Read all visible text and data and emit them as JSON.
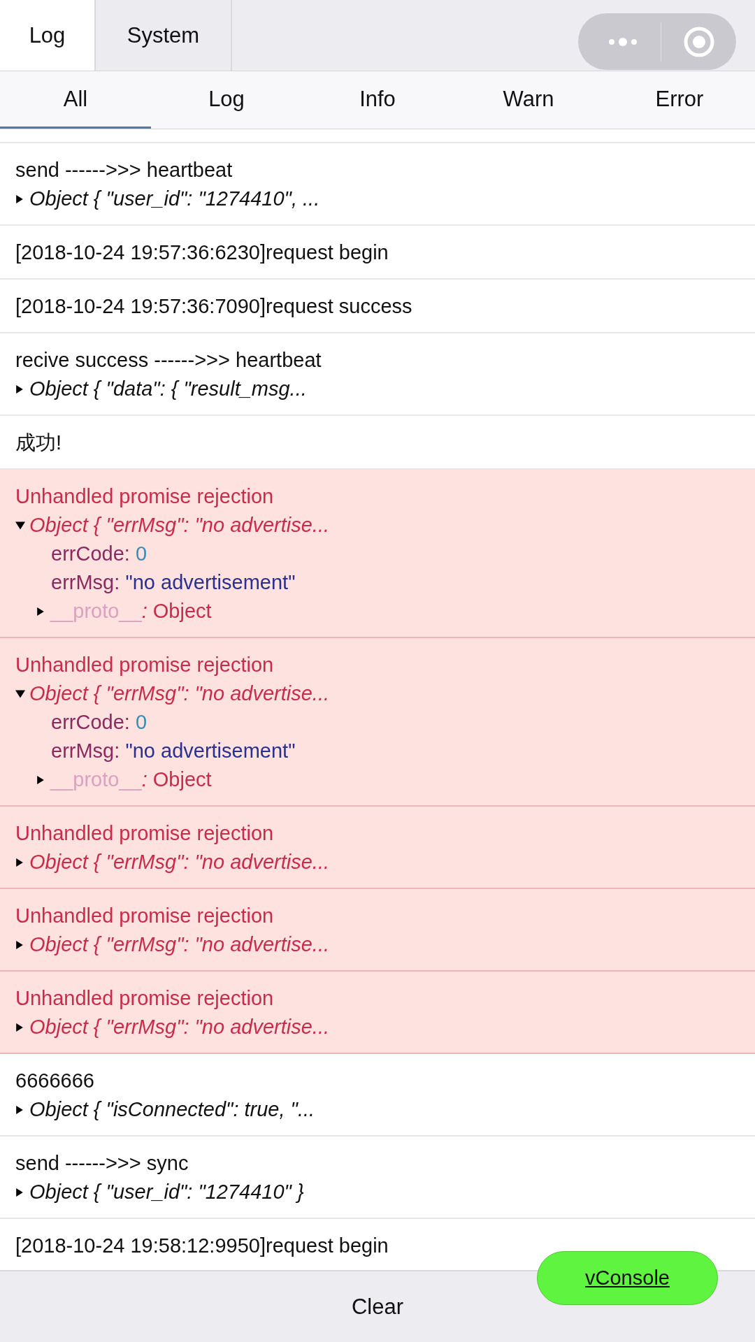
{
  "tabs": [
    {
      "label": "Log",
      "selected": true
    },
    {
      "label": "System",
      "selected": false
    }
  ],
  "filters": [
    {
      "label": "All",
      "selected": true
    },
    {
      "label": "Log",
      "selected": false
    },
    {
      "label": "Info",
      "selected": false
    },
    {
      "label": "Warn",
      "selected": false
    },
    {
      "label": "Error",
      "selected": false
    }
  ],
  "logs": [
    {
      "kind": "log",
      "message": "send ------>>> heartbeat",
      "object": {
        "summary": "Object { \"user_id\": \"1274410\", ...",
        "expanded": false
      }
    },
    {
      "kind": "log",
      "message": "[2018-10-24 19:57:36:6230]request begin"
    },
    {
      "kind": "log",
      "message": "[2018-10-24 19:57:36:7090]request success"
    },
    {
      "kind": "log",
      "message": "recive success ------>>> heartbeat",
      "object": {
        "summary": "Object { \"data\": { \"result_msg...",
        "expanded": false
      }
    },
    {
      "kind": "log",
      "message": "成功!"
    },
    {
      "kind": "error",
      "message": "Unhandled promise rejection",
      "object": {
        "summary": "Object { \"errMsg\": \"no advertise...",
        "expanded": true,
        "fields": [
          {
            "key": "errCode",
            "sep": ":",
            "value": "0",
            "kind": "number"
          },
          {
            "key": "errMsg",
            "sep": ":",
            "value": "\"no advertisement\"",
            "kind": "string"
          },
          {
            "key": "__proto__",
            "sep": ":",
            "value": "Object",
            "kind": "proto"
          }
        ]
      }
    },
    {
      "kind": "error",
      "message": "Unhandled promise rejection",
      "object": {
        "summary": "Object { \"errMsg\": \"no advertise...",
        "expanded": true,
        "fields": [
          {
            "key": "errCode",
            "sep": ":",
            "value": "0",
            "kind": "number"
          },
          {
            "key": "errMsg",
            "sep": ":",
            "value": "\"no advertisement\"",
            "kind": "string"
          },
          {
            "key": "__proto__",
            "sep": ":",
            "value": "Object",
            "kind": "proto"
          }
        ]
      }
    },
    {
      "kind": "error",
      "message": "Unhandled promise rejection",
      "object": {
        "summary": "Object { \"errMsg\": \"no advertise...",
        "expanded": false
      }
    },
    {
      "kind": "error",
      "message": "Unhandled promise rejection",
      "object": {
        "summary": "Object { \"errMsg\": \"no advertise...",
        "expanded": false
      }
    },
    {
      "kind": "error",
      "message": "Unhandled promise rejection",
      "object": {
        "summary": "Object { \"errMsg\": \"no advertise...",
        "expanded": false
      }
    },
    {
      "kind": "log",
      "message": "6666666",
      "object": {
        "summary": "Object { \"isConnected\": true, \"...",
        "expanded": false
      }
    },
    {
      "kind": "log",
      "message": "send ------>>> sync",
      "object": {
        "summary": "Object { \"user_id\": \"1274410\" }",
        "expanded": false
      }
    },
    {
      "kind": "log",
      "message": "[2018-10-24 19:58:12:9950]request begin"
    }
  ],
  "clear_button": "Clear",
  "float_button": "vConsole"
}
